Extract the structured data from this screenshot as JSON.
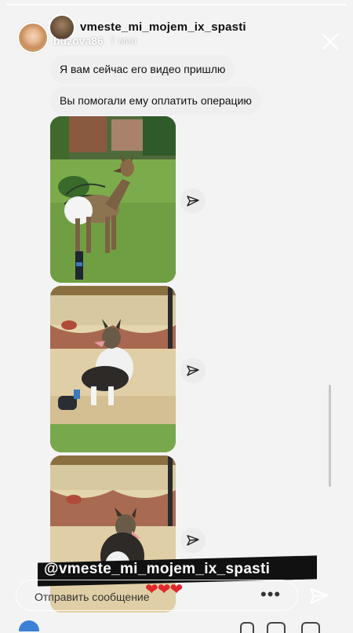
{
  "story": {
    "progress": 1.0,
    "username": "buzova86",
    "time": "7 мин"
  },
  "dm": {
    "title": "vmeste_mi_mojem_ix_spasti"
  },
  "messages": [
    {
      "text": "Я вам сейчас его видео пришлю"
    },
    {
      "text": "Вы помогали ему оплатить операцию"
    }
  ],
  "photos": [
    {
      "description": "dog-standing-on-grass",
      "icon": "share-icon"
    },
    {
      "description": "dog-sitting-on-swing",
      "icon": "share-icon"
    },
    {
      "description": "dog-on-swing-closeup",
      "icon": "share-icon"
    }
  ],
  "overlay": {
    "mention": "@vmeste_mi_mojem_ix_spasti",
    "hearts": "❤❤❤"
  },
  "reply": {
    "placeholder": "Отправить сообщение"
  },
  "colors": {
    "bubble": "#efefef",
    "heart": "#e0262f",
    "mention_band": "#111111"
  }
}
